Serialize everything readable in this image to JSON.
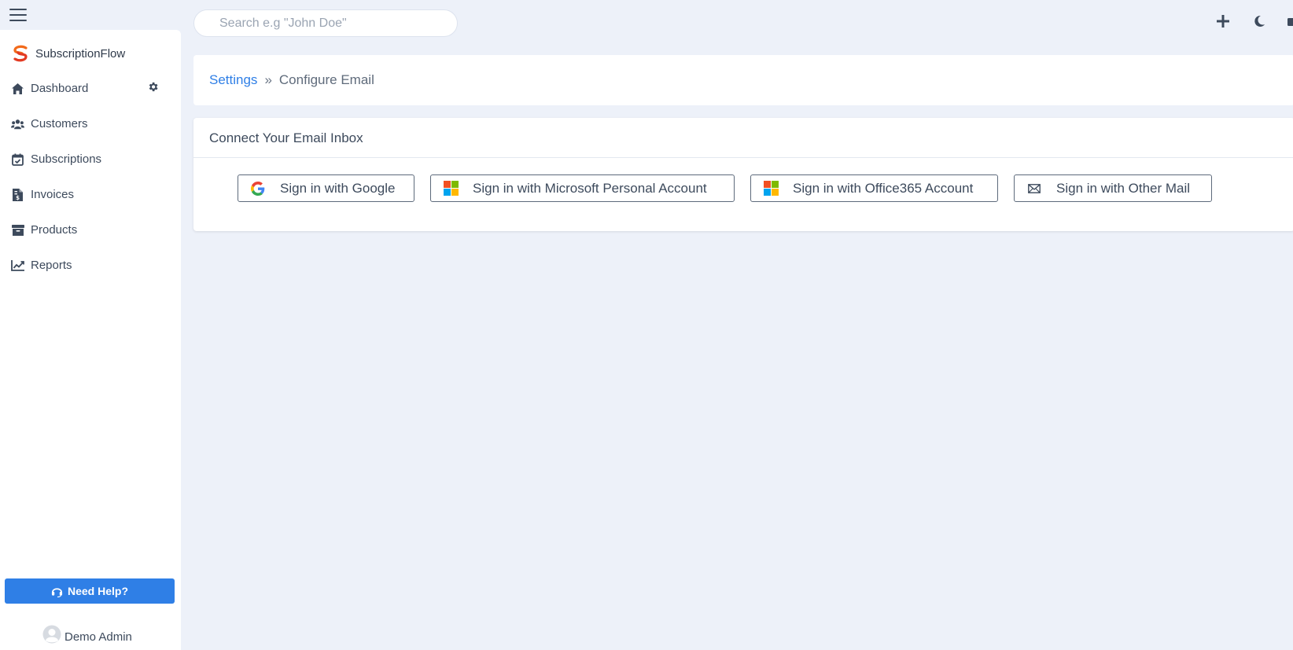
{
  "app": {
    "brand_name": "SubscriptionFlow"
  },
  "sidebar": {
    "items": [
      {
        "label": "Dashboard",
        "icon": "home-icon"
      },
      {
        "label": "Customers",
        "icon": "users-icon"
      },
      {
        "label": "Subscriptions",
        "icon": "calendar-check-icon"
      },
      {
        "label": "Invoices",
        "icon": "invoice-icon"
      },
      {
        "label": "Products",
        "icon": "archive-icon"
      },
      {
        "label": "Reports",
        "icon": "chart-line-icon"
      }
    ],
    "help_label": "Need Help?",
    "user_name": "Demo Admin"
  },
  "search": {
    "placeholder": "Search e.g \"John Doe\""
  },
  "breadcrumb": {
    "parent": "Settings",
    "separator": "»",
    "current": "Configure Email"
  },
  "email_card": {
    "title": "Connect Your Email Inbox",
    "buttons": [
      {
        "label": "Sign in with Google",
        "icon": "google-icon"
      },
      {
        "label": "Sign in with Microsoft Personal Account",
        "icon": "microsoft-icon"
      },
      {
        "label": "Sign in with Office365 Account",
        "icon": "office365-icon"
      },
      {
        "label": "Sign in with Other Mail",
        "icon": "envelope-icon"
      }
    ]
  },
  "colors": {
    "accent": "#2f7fe6",
    "background": "#edf1f9",
    "arrow": "#f0341f",
    "ms_red": "#f25022",
    "ms_green": "#7fba00",
    "ms_blue": "#00a4ef",
    "ms_yellow": "#ffb900"
  }
}
